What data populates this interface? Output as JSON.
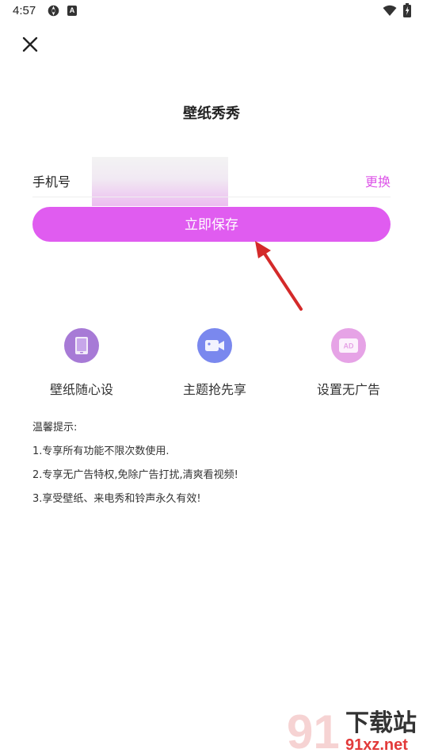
{
  "status_bar": {
    "time": "4:57",
    "icon_a_letter": "A"
  },
  "header": {
    "title": "壁纸秀秀"
  },
  "phone": {
    "label": "手机号",
    "value": "",
    "change_label": "更换"
  },
  "save_button": {
    "label": "立即保存"
  },
  "features": [
    {
      "label": "壁纸随心设",
      "icon": "phone-icon"
    },
    {
      "label": "主题抢先享",
      "icon": "video-icon"
    },
    {
      "label": "设置无广告",
      "icon": "ad-icon",
      "icon_text": "AD"
    }
  ],
  "tips": {
    "title": "温馨提示:",
    "items": [
      "1.专享所有功能不限次数使用.",
      "2.专享无广告特权,免除广告打扰,清爽看视频!",
      "3.享受壁纸、来电秀和铃声永久有效!"
    ]
  },
  "watermark": {
    "logo_text": "91",
    "brand": "下载站",
    "url": "91xz.net"
  },
  "colors": {
    "accent": "#e05cf0",
    "link": "#dd55e8",
    "arrow": "#d42a2a"
  }
}
